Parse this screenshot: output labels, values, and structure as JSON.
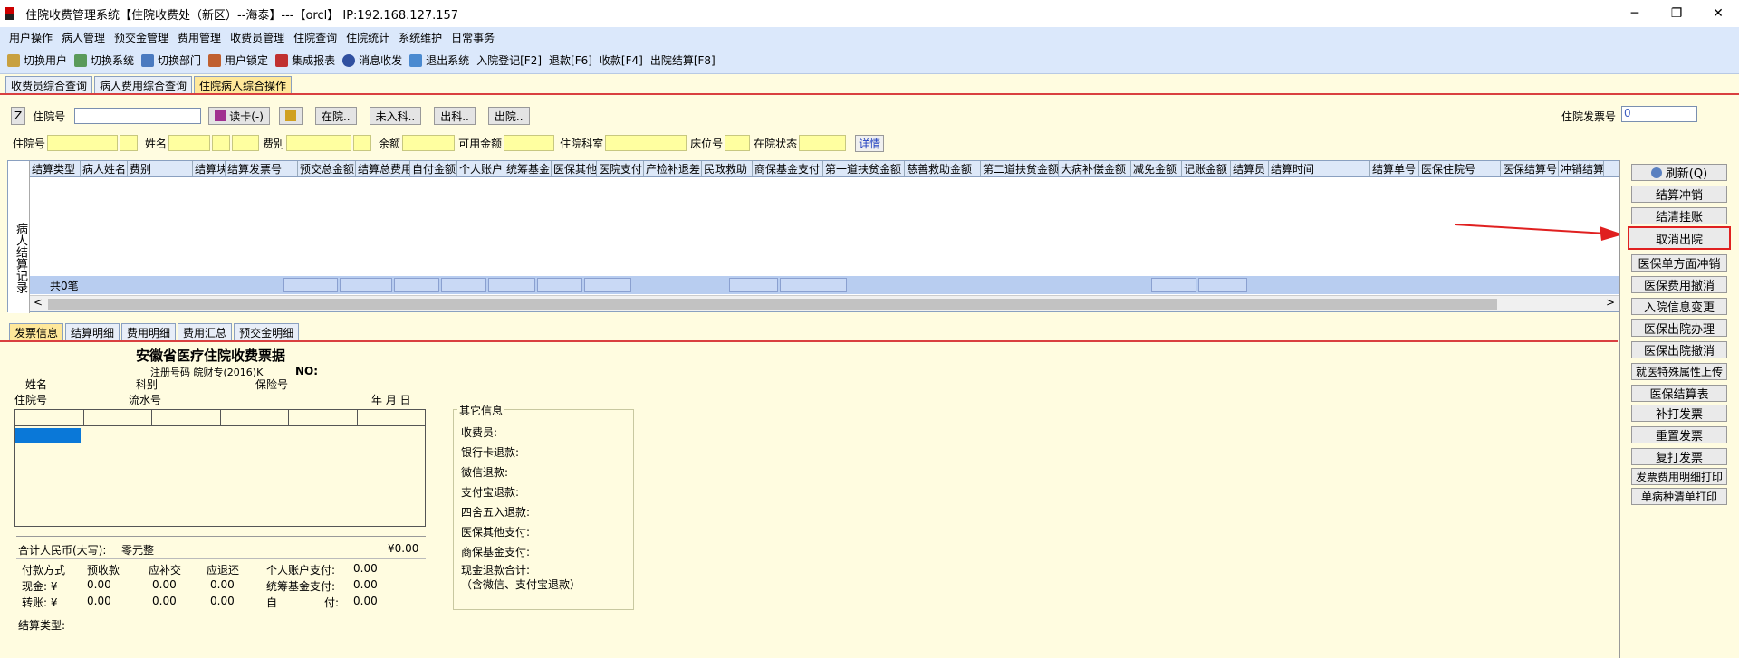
{
  "window": {
    "title": "住院收费管理系统【住院收费处（新区）--海泰】---【orcl】  IP:192.168.127.157",
    "minimize": "─",
    "maximize": "❐",
    "close": "✕"
  },
  "menu": [
    "用户操作",
    "病人管理",
    "预交金管理",
    "费用管理",
    "收费员管理",
    "住院查询",
    "住院统计",
    "系统维护",
    "日常事务"
  ],
  "toolbar": [
    {
      "label": "切换用户",
      "icon": "users-icon",
      "color": "#c8a040"
    },
    {
      "label": "切换系统",
      "icon": "system-icon",
      "color": "#5a9a5a"
    },
    {
      "label": "切换部门",
      "icon": "department-icon",
      "color": "#4a7ac0"
    },
    {
      "label": "用户锁定",
      "icon": "lock-icon",
      "color": "#c06030"
    },
    {
      "label": "集成报表",
      "icon": "report-icon",
      "color": "#c03030"
    },
    {
      "label": "消息收发",
      "icon": "info-icon",
      "color": "#3050a0"
    },
    {
      "label": "退出系统",
      "icon": "exit-icon",
      "color": "#4a8ad0"
    },
    {
      "label": "入院登记[F2]"
    },
    {
      "label": "退款[F6]"
    },
    {
      "label": "收款[F4]"
    },
    {
      "label": "出院结算[F8]"
    }
  ],
  "top_tabs": [
    "收费员综合查询",
    "病人费用综合查询",
    "住院病人综合操作"
  ],
  "row1": {
    "z": "Z",
    "hosp_no_label": "住院号",
    "read_card": "读卡(-)",
    "btn_zaiyuan": "在院..",
    "btn_weiruke": "未入科..",
    "btn_chuke": "出科..",
    "btn_chuyuan": "出院..",
    "invoice_label": "住院发票号",
    "invoice_value": "0"
  },
  "row2": {
    "hosp_no": "住院号",
    "name": "姓名",
    "fee_type": "费别",
    "balance": "余额",
    "avail": "可用金额",
    "dept": "住院科室",
    "bed": "床位号",
    "status": "在院状态",
    "detail": "详情"
  },
  "grid": {
    "side_label": "病人结算记录",
    "columns": [
      "结算类型",
      "病人姓名",
      "费别",
      "结算块",
      "结算发票号",
      "预交总金额",
      "结算总费用",
      "自付金额",
      "个人账户",
      "统筹基金",
      "医保其他",
      "医院支付",
      "产检补退差",
      "民政救助",
      "商保基金支付",
      "第一道扶贫金额",
      "慈善救助金额",
      "第二道扶贫金额",
      "大病补偿金额",
      "减免金额",
      "记账金额",
      "结算员",
      "结算时间",
      "结算单号",
      "医保住院号",
      "医保结算号",
      "冲销结算"
    ],
    "total": "共0笔"
  },
  "bottom_tabs": [
    "发票信息",
    "结算明细",
    "费用明细",
    "费用汇总",
    "预交金明细"
  ],
  "receipt": {
    "title": "安徽省医疗住院收费票据",
    "reg": "注册号码 皖财专(2016)K",
    "no": "NO:",
    "name": "姓名",
    "dept": "科别",
    "ins": "保险号",
    "hosp_no": "住院号",
    "serial": "流水号",
    "ymd": "年  月  日",
    "total_label": "合计人民币(大写):",
    "total_cn": "零元整",
    "total_amt": "¥0.00",
    "pay_method": "付款方式",
    "prepay": "预收款",
    "supplement": "应补交",
    "refund": "应退还",
    "personal": "个人账户支付:",
    "cash": "现金: ¥",
    "transfer": "转账: ¥",
    "zero": "0.00",
    "pooled": "统筹基金支付:",
    "self": "自",
    "pay": "付:",
    "settle_type": "结算类型:"
  },
  "other": {
    "legend": "其它信息",
    "lines": [
      "收费员:",
      "银行卡退款:",
      "微信退款:",
      "支付宝退款:",
      "四舍五入退款:",
      "医保其他支付:",
      "商保基金支付:",
      "现金退款合计:",
      "（含微信、支付宝退款）"
    ]
  },
  "right_buttons": [
    "刷新(Q)",
    "结算冲销",
    "结清挂账",
    "取消出院",
    "医保单方面冲销",
    "医保费用撤消",
    "入院信息变更",
    "医保出院办理",
    "医保出院撤消",
    "就医特殊属性上传",
    "医保结算表",
    "补打发票",
    "重置发票",
    "复打发票",
    "发票费用明细打印",
    "单病种清单打印"
  ],
  "highlight_color": "#e02020"
}
